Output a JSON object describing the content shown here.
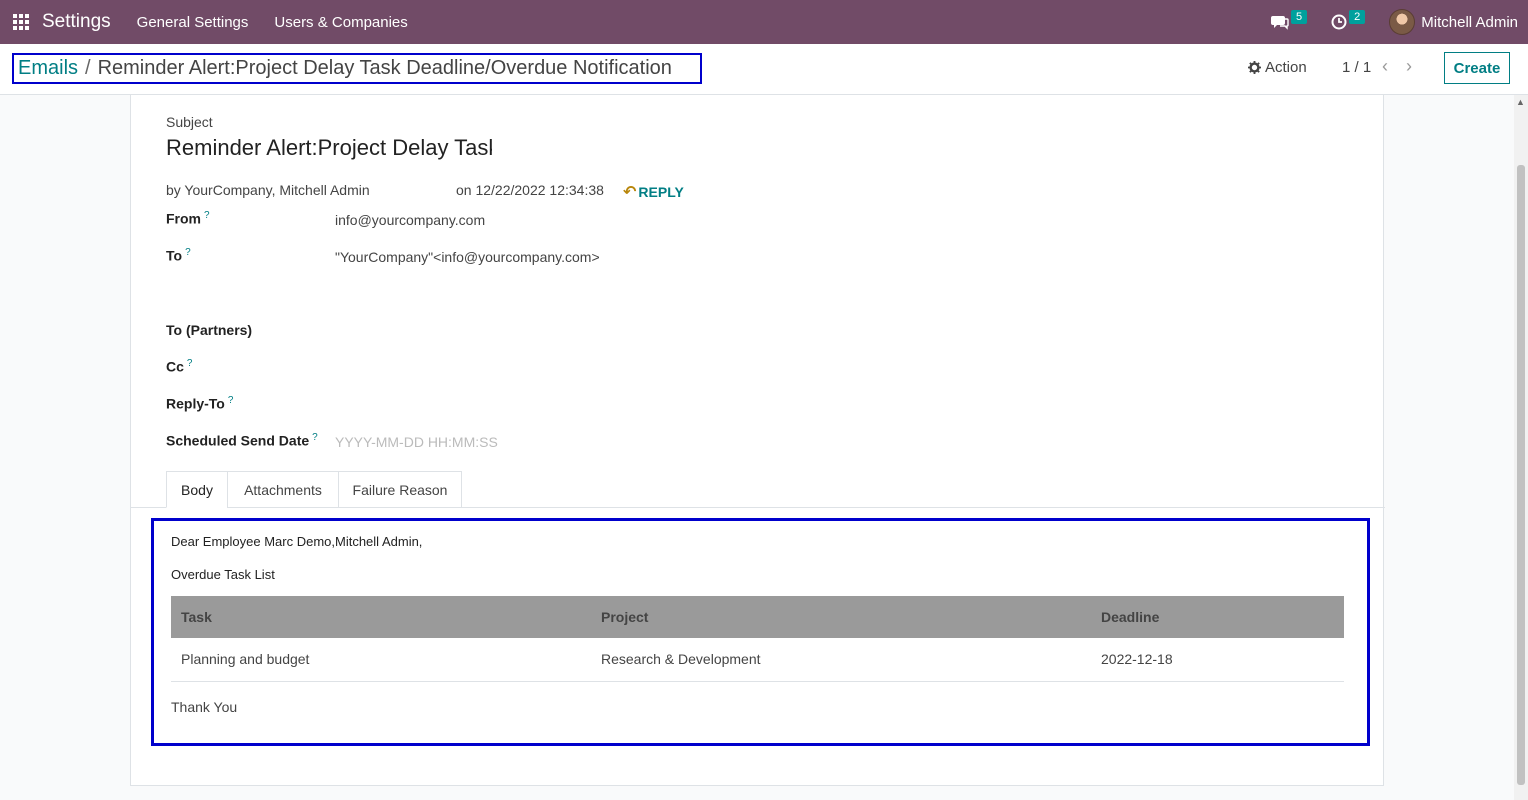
{
  "navbar": {
    "app_name": "Settings",
    "menu": [
      "General Settings",
      "Users & Companies"
    ],
    "messages_count": "5",
    "activities_count": "2",
    "user_name": "Mitchell Admin"
  },
  "control_panel": {
    "breadcrumb_parent": "Emails",
    "breadcrumb_separator": "/",
    "breadcrumb_current": "Reminder Alert:Project Delay Task Deadline/Overdue Notification",
    "action_label": "Action",
    "pager": "1 / 1",
    "create_label": "Create"
  },
  "email": {
    "subject_label": "Subject",
    "subject_value": "Reminder Alert:Project Delay Task Deadline/Overdue Notification",
    "by_text": "by YourCompany, Mitchell Admin",
    "on_text": "on 12/22/2022 12:34:38",
    "reply_label": "REPLY",
    "fields": {
      "from_label": "From",
      "from_value": "info@yourcompany.com",
      "to_label": "To",
      "to_value": "\"YourCompany\"<info@yourcompany.com>",
      "to_partners_label": "To (Partners)",
      "cc_label": "Cc",
      "reply_to_label": "Reply-To",
      "scheduled_label": "Scheduled Send Date",
      "scheduled_placeholder": "YYYY-MM-DD HH:MM:SS",
      "help_mark": "?"
    },
    "tabs": [
      "Body",
      "Attachments",
      "Failure Reason"
    ],
    "body": {
      "greeting": "Dear Employee Marc Demo,Mitchell Admin,",
      "list_title": "Overdue Task List",
      "table": {
        "headers": [
          "Task",
          "Project",
          "Deadline"
        ],
        "rows": [
          [
            "Planning and budget",
            "Research & Development",
            "2022-12-18"
          ]
        ]
      },
      "closing": "Thank You"
    }
  },
  "colors": {
    "navbar": "#714b67",
    "link": "#017e84",
    "highlight_border": "#0000cc",
    "table_header": "#9a9a9a"
  }
}
